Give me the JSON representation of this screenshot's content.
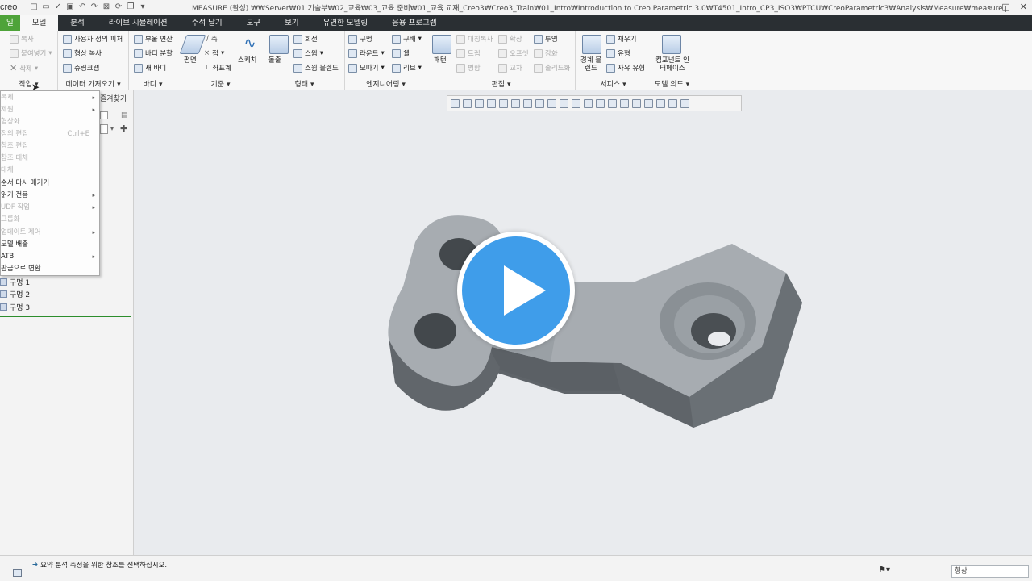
{
  "titlebar": {
    "logo": "creo",
    "title": "MEASURE (활성) ₩₩Server₩01 기술부₩02_교육₩03_교육 준비₩01_교육 교재_Creo3₩Creo3_Train₩01_Intro₩Introduction to Creo Parametric 3.0₩T4501_Intro_CP3_ISO3₩PTCU₩CreoParametric3₩Analysis₩Measure₩measure.prt - Creo Parametric"
  },
  "tabs": [
    "일",
    "모델",
    "분석",
    "라이브 시뮬레이션",
    "주석 달기",
    "도구",
    "보기",
    "유연한 모델링",
    "응용 프로그램"
  ],
  "ribbon": {
    "operations": {
      "items": [
        "복사",
        "붙여넣기",
        "삭제"
      ],
      "label": "작업"
    },
    "get_data": {
      "items": [
        "사용자 정의 피처",
        "형상 복사",
        "슈링크랩"
      ],
      "label": "데이터 가져오기"
    },
    "body": {
      "items": [
        "부울 연산",
        "바디 분할",
        "새 바디"
      ],
      "label": "바디"
    },
    "datum": {
      "items": [
        "평면",
        "축",
        "점",
        "좌표계",
        "스케치"
      ],
      "label": "기준"
    },
    "shapes": {
      "items": [
        "돌출",
        "회전",
        "스윕",
        "스윕 블렌드"
      ],
      "label": "형태"
    },
    "engineering": {
      "items": [
        "구멍",
        "라운드",
        "모따기",
        "구배",
        "쉘",
        "리브"
      ],
      "label": "엔지니어링"
    },
    "editing": {
      "items": [
        "패턴",
        "대칭복사",
        "트림",
        "병합",
        "확장",
        "오프셋",
        "교차",
        "투영",
        "강화",
        "솔리드화"
      ],
      "label": "편집"
    },
    "surfaces": {
      "items": [
        "경계 블렌드",
        "채우기",
        "유형",
        "자유 유형"
      ],
      "label": "서피스"
    },
    "model_intent": {
      "items": [
        "컴포넌트 인터페이스"
      ],
      "label": "모델 의도"
    }
  },
  "panel": {
    "favorites_tab": "즐겨찾기",
    "tree_items": [
      "구멍 1",
      "구멍 2",
      "구멍 3"
    ]
  },
  "dropdown_menu": {
    "items": [
      {
        "label": "복제",
        "disabled": true,
        "submenu": true
      },
      {
        "label": "제원",
        "disabled": true,
        "submenu": true
      },
      {
        "label": "형상화",
        "disabled": true,
        "submenu": false
      },
      {
        "label": "정의 편집",
        "disabled": true,
        "submenu": false,
        "shortcut": "Ctrl+E"
      },
      {
        "label": "참조 편집",
        "disabled": true,
        "submenu": false
      },
      {
        "label": "참조 대체",
        "disabled": true,
        "submenu": false
      },
      {
        "label": "대체",
        "disabled": true,
        "submenu": false
      },
      {
        "label": "순서 다시 매기기",
        "disabled": false,
        "submenu": false
      },
      {
        "label": "읽기 전용",
        "disabled": false,
        "submenu": true
      },
      {
        "label": "UDF 작업",
        "disabled": true,
        "submenu": true
      },
      {
        "label": "그룹화",
        "disabled": true,
        "submenu": false
      },
      {
        "label": "업데이트 제어",
        "disabled": true,
        "submenu": true
      },
      {
        "label": "모델 배출",
        "disabled": false,
        "submenu": false
      },
      {
        "label": "ATB",
        "disabled": false,
        "submenu": true
      },
      {
        "label": "판금으로 변환",
        "disabled": false,
        "submenu": false
      }
    ]
  },
  "status": {
    "message": "요약 분석 측정을 위한 참조를 선택하십시오.",
    "filter_value": "형상"
  },
  "colors": {
    "file_tab": "#4ea339",
    "tab_bar": "#2a2f33",
    "play": "#3f9dea",
    "part": "#8e9398"
  }
}
